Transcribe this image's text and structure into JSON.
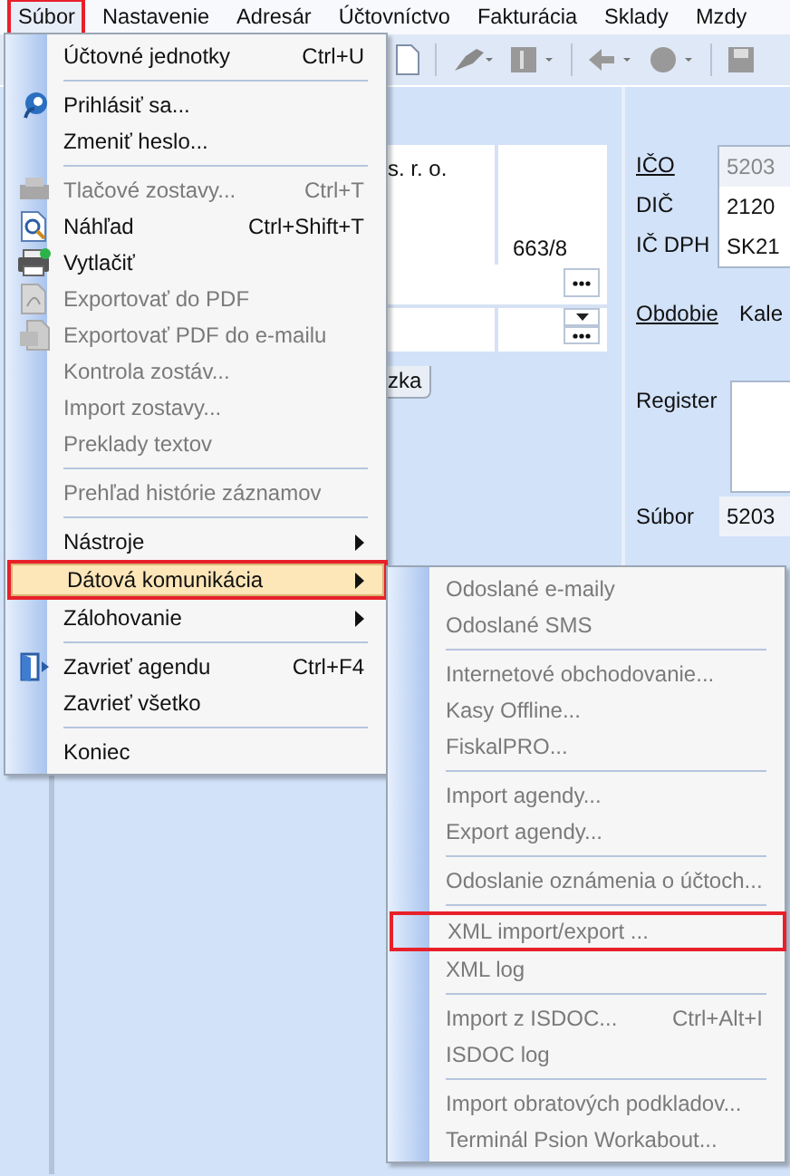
{
  "menu_bar": [
    {
      "label": "Súbor",
      "selected": true,
      "highlighted": true
    },
    {
      "label": "Nastavenie",
      "selected": false,
      "highlighted": false
    },
    {
      "label": "Adresár",
      "selected": false,
      "highlighted": false
    },
    {
      "label": "Účtovníctvo",
      "selected": false,
      "highlighted": false
    },
    {
      "label": "Fakturácia",
      "selected": false,
      "highlighted": false
    },
    {
      "label": "Sklady",
      "selected": false,
      "highlighted": false
    },
    {
      "label": "Mzdy",
      "selected": false,
      "highlighted": false
    }
  ],
  "form": {
    "company_name": "s. r. o.",
    "street_number": "663/8",
    "tab": "zka",
    "ico_label": "IČO",
    "ico_value": "5203",
    "dic_label": "DIČ",
    "dic_value": "2120",
    "icdph_label": "IČ DPH",
    "icdph_value": "SK21",
    "period_label": "Obdobie",
    "period_value": "Kale",
    "register_label": "Register",
    "file_label": "Súbor",
    "file_value": "5203"
  },
  "file_menu": [
    {
      "kind": "item",
      "label": "Účtovné jednotky",
      "shortcut": "Ctrl+U",
      "disabled": false,
      "submenu": false,
      "selected": false,
      "highlighted": false
    },
    {
      "kind": "separator"
    },
    {
      "kind": "item",
      "label": "Prihlásiť sa...",
      "disabled": false,
      "submenu": false,
      "selected": false,
      "highlighted": false
    },
    {
      "kind": "item",
      "label": "Zmeniť heslo...",
      "disabled": false,
      "submenu": false,
      "selected": false,
      "highlighted": false
    },
    {
      "kind": "separator"
    },
    {
      "kind": "item",
      "label": "Tlačové zostavy...",
      "shortcut": "Ctrl+T",
      "disabled": true,
      "submenu": false,
      "selected": false,
      "highlighted": false
    },
    {
      "kind": "item",
      "label": "Náhľad",
      "shortcut": "Ctrl+Shift+T",
      "disabled": false,
      "submenu": false,
      "selected": false,
      "highlighted": false
    },
    {
      "kind": "item",
      "label": "Vytlačiť",
      "disabled": false,
      "submenu": false,
      "selected": false,
      "highlighted": false
    },
    {
      "kind": "item",
      "label": "Exportovať do PDF",
      "disabled": true,
      "submenu": false,
      "selected": false,
      "highlighted": false
    },
    {
      "kind": "item",
      "label": "Exportovať PDF do e-mailu",
      "disabled": true,
      "submenu": false,
      "selected": false,
      "highlighted": false
    },
    {
      "kind": "item",
      "label": "Kontrola zostáv...",
      "disabled": true,
      "submenu": false,
      "selected": false,
      "highlighted": false
    },
    {
      "kind": "item",
      "label": "Import zostavy...",
      "disabled": true,
      "submenu": false,
      "selected": false,
      "highlighted": false
    },
    {
      "kind": "item",
      "label": "Preklady textov",
      "disabled": true,
      "submenu": false,
      "selected": false,
      "highlighted": false
    },
    {
      "kind": "separator"
    },
    {
      "kind": "item",
      "label": "Prehľad histórie záznamov",
      "disabled": true,
      "submenu": false,
      "selected": false,
      "highlighted": false
    },
    {
      "kind": "separator"
    },
    {
      "kind": "item",
      "label": "Nástroje",
      "disabled": false,
      "submenu": true,
      "selected": false,
      "highlighted": false
    },
    {
      "kind": "item",
      "label": "Dátová komunikácia",
      "disabled": false,
      "submenu": true,
      "selected": true,
      "highlighted": true
    },
    {
      "kind": "item",
      "label": "Zálohovanie",
      "disabled": false,
      "submenu": true,
      "selected": false,
      "highlighted": false
    },
    {
      "kind": "separator"
    },
    {
      "kind": "item",
      "label": "Zavrieť agendu",
      "shortcut": "Ctrl+F4",
      "disabled": false,
      "submenu": false,
      "selected": false,
      "highlighted": false
    },
    {
      "kind": "item",
      "label": "Zavrieť všetko",
      "disabled": false,
      "submenu": false,
      "selected": false,
      "highlighted": false
    },
    {
      "kind": "separator"
    },
    {
      "kind": "item",
      "label": "Koniec",
      "disabled": false,
      "submenu": false,
      "selected": false,
      "highlighted": false
    }
  ],
  "data_menu": [
    {
      "kind": "item",
      "label": "Odoslané e-maily",
      "disabled": true,
      "selected": false,
      "highlighted": false
    },
    {
      "kind": "item",
      "label": "Odoslané SMS",
      "disabled": true,
      "selected": false,
      "highlighted": false
    },
    {
      "kind": "separator"
    },
    {
      "kind": "item",
      "label": "Internetové obchodovanie...",
      "disabled": true,
      "selected": false,
      "highlighted": false
    },
    {
      "kind": "item",
      "label": "Kasy Offline...",
      "disabled": true,
      "selected": false,
      "highlighted": false
    },
    {
      "kind": "item",
      "label": "FiskalPRO...",
      "disabled": true,
      "selected": false,
      "highlighted": false
    },
    {
      "kind": "separator"
    },
    {
      "kind": "item",
      "label": "Import agendy...",
      "disabled": true,
      "selected": false,
      "highlighted": false
    },
    {
      "kind": "item",
      "label": "Export agendy...",
      "disabled": true,
      "selected": false,
      "highlighted": false
    },
    {
      "kind": "separator"
    },
    {
      "kind": "item",
      "label": "Odoslanie oznámenia o účtoch...",
      "disabled": true,
      "selected": false,
      "highlighted": false
    },
    {
      "kind": "separator"
    },
    {
      "kind": "item",
      "label": "XML import/export ...",
      "disabled": true,
      "selected": false,
      "highlighted": true
    },
    {
      "kind": "item",
      "label": "XML log",
      "disabled": true,
      "selected": false,
      "highlighted": false
    },
    {
      "kind": "separator"
    },
    {
      "kind": "item",
      "label": "Import z ISDOC...",
      "shortcut": "Ctrl+Alt+I",
      "disabled": true,
      "selected": false,
      "highlighted": false
    },
    {
      "kind": "item",
      "label": "ISDOC log",
      "disabled": true,
      "selected": false,
      "highlighted": false
    },
    {
      "kind": "separator"
    },
    {
      "kind": "item",
      "label": "Import obratových podkladov...",
      "disabled": true,
      "selected": false,
      "highlighted": false
    },
    {
      "kind": "item",
      "label": "Terminál Psion Workabout...",
      "disabled": true,
      "selected": false,
      "highlighted": false
    }
  ]
}
